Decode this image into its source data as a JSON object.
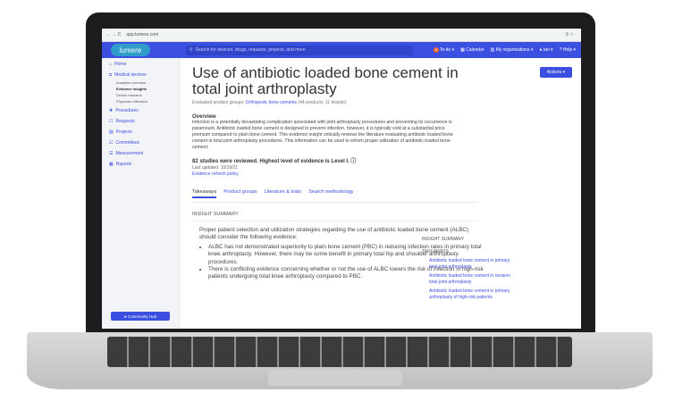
{
  "browser": {
    "nav": "← → C",
    "url": "app.lumere.com",
    "right": "⚲ ☆"
  },
  "topbar": {
    "logo": "lumere",
    "search_placeholder": "Search for devices, drugs, requests, projects, and more",
    "todo_count": "3",
    "todo": "To-do ▾",
    "calendar": "Calendar",
    "orgs": "My organizations ▾",
    "user": "Ian ▾",
    "help": "Help ▾"
  },
  "sidebar": {
    "home": "Home",
    "medical_devices": "Medical devices",
    "subs": [
      "Analytics overview",
      "Evidence insights",
      "Device research",
      "Physician utilization"
    ],
    "procedures": "Procedures",
    "requests": "Requests",
    "projects": "Projects",
    "committees": "Committees",
    "measurement": "Measurement",
    "reports": "Reports",
    "community": "Community Hub"
  },
  "page": {
    "title": "Use of antibiotic loaded bone cement in total joint arthroplasty",
    "actions": "Actions ▾",
    "groups_label": "Evaluated product groups: ",
    "groups_link": "Orthopedic bone cements",
    "groups_count": " (44 products, 11 brands)",
    "overview_heading": "Overview",
    "overview_text": "Infection is a potentially devastating complication associated with joint arthroplasty procedures and preventing its occurrence is paramount. Antibiotic loaded bone cement is designed to prevent infection, however, it is typically sold at a substantial price premium compared to plain bone cement. This evidence insight critically reviews the literature evaluating antibiotic loaded bone cement in total joint arthroplasty procedures. This information can be used to inform proper utilization of antibiotic loaded bone cement.",
    "studies": "82 studies were reviewed. Highest level of evidence is Level I.",
    "updated": "Last updated: 10/19/21",
    "refresh": "Evidence refresh policy",
    "tabs": [
      "Takeaways",
      "Product groups",
      "Literature & trials",
      "Search methodology"
    ],
    "insight_heading": "INSIGHT SUMMARY",
    "insight_intro": "Proper patient selection and utilization strategies regarding the use of antibiotic loaded bone cement (ALBC) should consider the following evidence:",
    "bullets": [
      "ALBC has not demonstrated superiority to plain bone cement (PBC) in reducing infection rates in primary total knee arthroplasty. However, there may be some benefit in primary total hip and shoulder arthroplasty procedures.",
      "There is conflicting evidence concerning whether or not the use of ALBC lowers the risk of infection in high-risk patients undergoing total knee arthroplasty compared to PBC."
    ]
  },
  "rightpanel": {
    "insight": "INSIGHT SUMMARY",
    "takeaways": "TAKEAWAYS",
    "items": [
      "Antibiotic loaded bone cement in primary total joint arthroplasty",
      "Antibiotic loaded bone cement in revision total joint arthroplasty",
      "Antibiotic loaded bone cement in primary arthroplasty of high-risk patients"
    ]
  }
}
